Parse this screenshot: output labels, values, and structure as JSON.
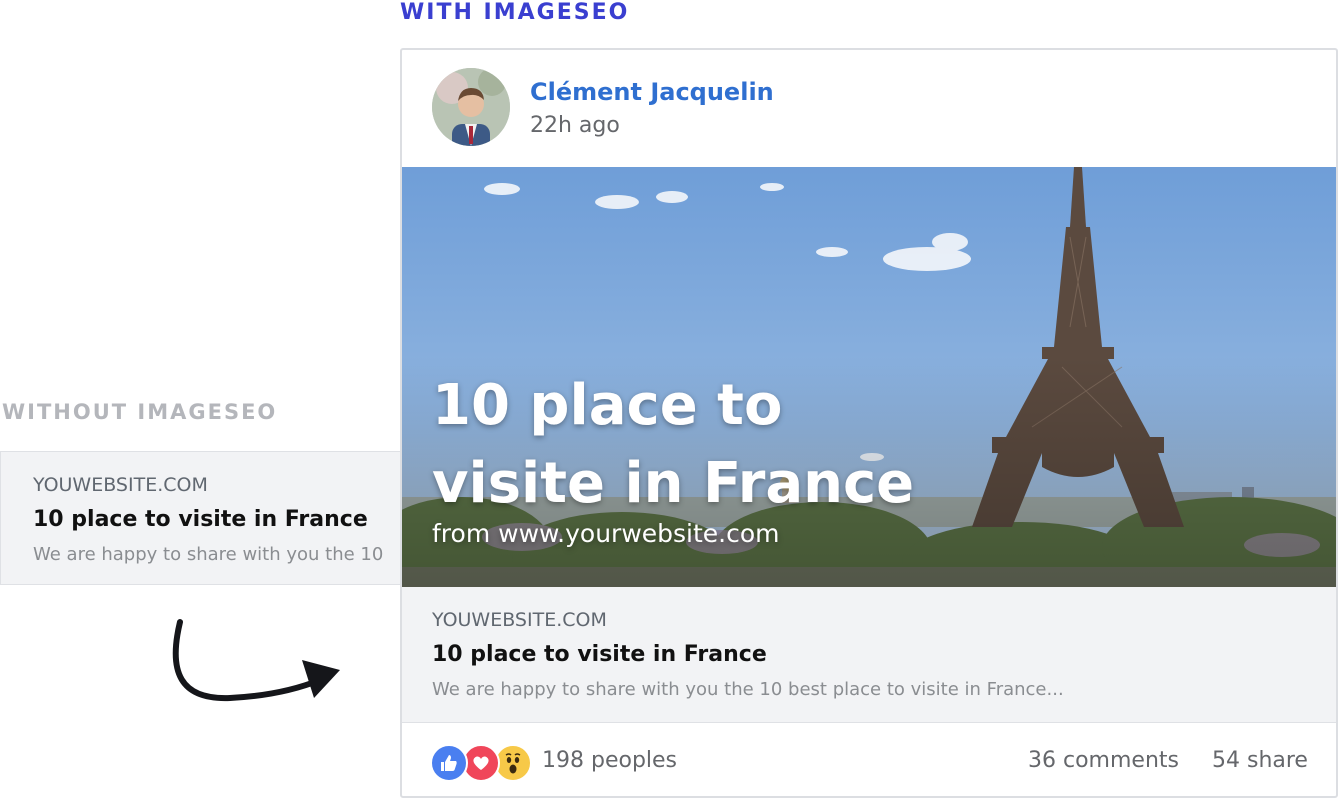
{
  "labels": {
    "with": "WITH IMAGESEO",
    "without": "WITHOUT IMAGESEO"
  },
  "without_card": {
    "domain": "YOUWEBSITE.COM",
    "title": "10 place to visite in France",
    "description": "We are happy to share with you the 10"
  },
  "post": {
    "author": "Clément Jacquelin",
    "time": "22h ago",
    "hero": {
      "title": "10 place to visite in France",
      "subtitle": "from www.yourwebsite.com"
    },
    "link": {
      "domain": "YOUWEBSITE.COM",
      "title": "10 place to visite in France",
      "description": "We are happy to share with you the 10 best place to visite in France..."
    },
    "footer": {
      "reactions": [
        "like-icon",
        "love-icon",
        "wow-icon"
      ],
      "peoples": "198 peoples",
      "comments": "36 comments",
      "shares": "54 share"
    }
  },
  "colors": {
    "accent_with": "#3a3fd0",
    "label_without": "#b4b6bb",
    "author": "#2f6fd0",
    "card_bg": "#f2f3f5"
  }
}
